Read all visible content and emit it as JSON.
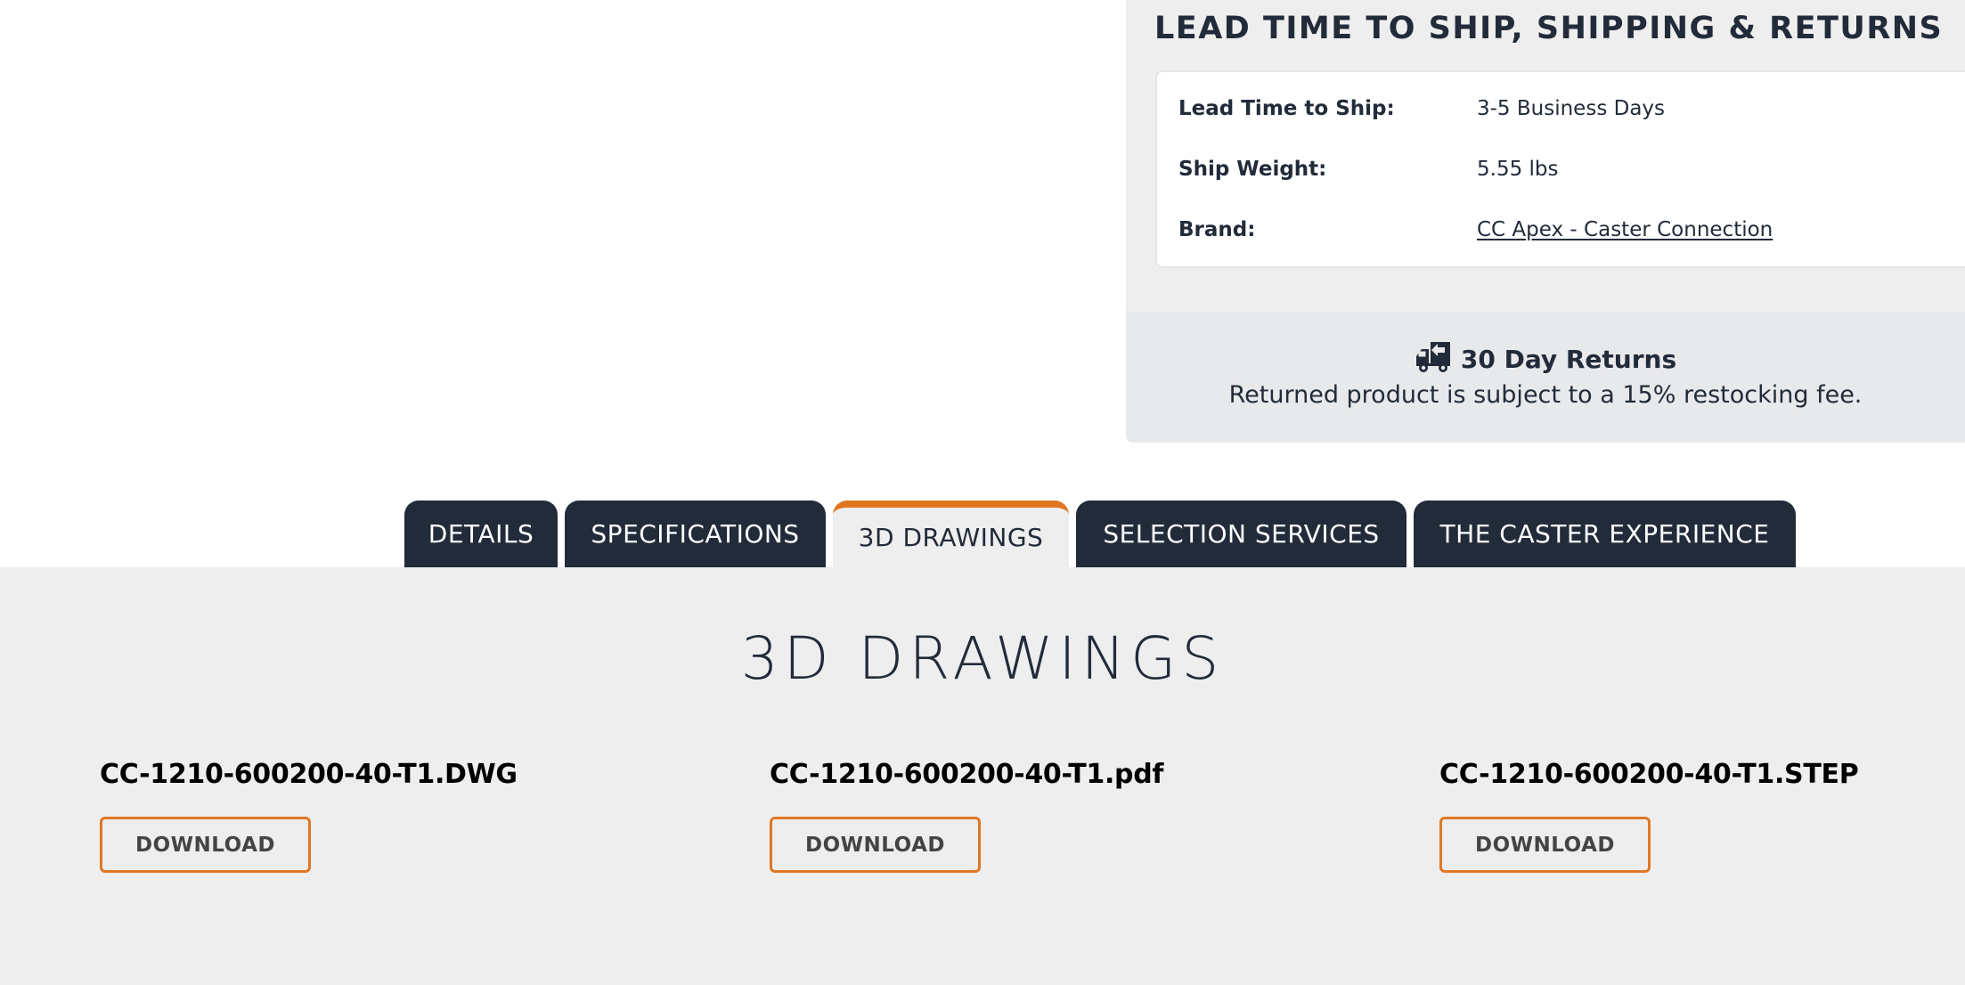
{
  "shipping": {
    "title": "LEAD TIME TO SHIP, SHIPPING & RETURNS",
    "rows": [
      {
        "label": "Lead Time to Ship:",
        "value": "3-5 Business Days"
      },
      {
        "label": "Ship Weight:",
        "value": "5.55 lbs"
      },
      {
        "label": "Brand:",
        "value": "CC Apex - Caster Connection",
        "is_link": true
      }
    ],
    "returns": {
      "icon": "return-truck-icon",
      "title": "30 Day Returns",
      "note": "Returned product is subject to a 15% restocking fee."
    }
  },
  "tabs": [
    {
      "label": "DETAILS",
      "active": false
    },
    {
      "label": "SPECIFICATIONS",
      "active": false
    },
    {
      "label": "3D DRAWINGS",
      "active": true
    },
    {
      "label": "SELECTION SERVICES",
      "active": false
    },
    {
      "label": "THE CASTER EXPERIENCE",
      "active": false
    }
  ],
  "drawings": {
    "title": "3D DRAWINGS",
    "files": [
      {
        "name": "CC-1210-600200-40-T1.DWG",
        "button_label": "DOWNLOAD"
      },
      {
        "name": "CC-1210-600200-40-T1.pdf",
        "button_label": "DOWNLOAD"
      },
      {
        "name": "CC-1210-600200-40-T1.STEP",
        "button_label": "DOWNLOAD"
      }
    ]
  },
  "colors": {
    "navy": "#222b3a",
    "accent_orange": "#e07720",
    "panel_bg": "#eeeeee",
    "returns_bg": "#e8e9eb"
  }
}
